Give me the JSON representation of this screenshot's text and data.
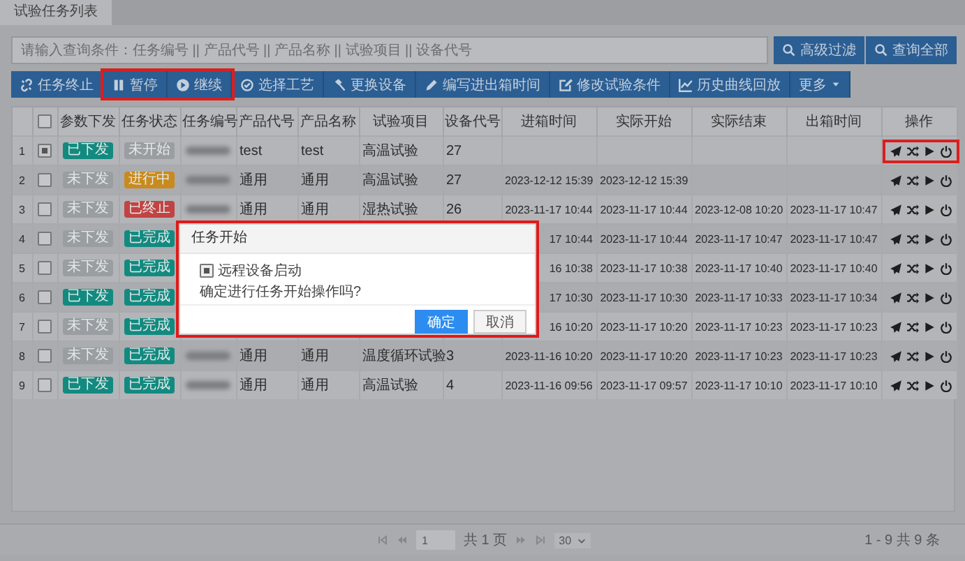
{
  "tabs": [
    {
      "label": "试验任务列表",
      "selected": true
    }
  ],
  "search": {
    "placeholder": "请输入查询条件：任务编号 || 产品代号 || 产品名称 || 试验项目 || 设备代号",
    "buttons": [
      "高级过滤",
      "查询全部"
    ]
  },
  "toolbar": [
    {
      "label": "任务终止",
      "highlighted": false
    },
    {
      "label": "暂停",
      "highlighted": true
    },
    {
      "label": "继续",
      "highlighted": true
    },
    {
      "label": "选择工艺",
      "highlighted": false
    },
    {
      "label": "更换设备",
      "highlighted": false
    },
    {
      "label": "编写进出箱时间",
      "highlighted": false
    },
    {
      "label": "修改试验条件",
      "highlighted": false
    },
    {
      "label": "历史曲线回放",
      "highlighted": false
    },
    {
      "label": "更多",
      "highlighted": false
    }
  ],
  "table": {
    "select_all_checked": false,
    "columns": [
      "参数下发",
      "任务状态",
      "任务编号",
      "产品代号",
      "产品名称",
      "试验项目",
      "设备代号",
      "进箱时间",
      "实际开始",
      "实际结束",
      "出箱时间",
      "操作"
    ],
    "rows": [
      {
        "index": "1",
        "checked": true,
        "param": {
          "label": "已下发",
          "color": "#138a80"
        },
        "status": {
          "label": "未开始",
          "color": "#9a9ea2"
        },
        "task_number_blurred": true,
        "product_code": "test",
        "product_name": "test",
        "test_item": "高温试验",
        "device_code": "27",
        "actions_highlighted": true
      },
      {
        "index": "2",
        "checked": false,
        "param": {
          "label": "未下发",
          "color": "#9a9ea2"
        },
        "status": {
          "label": "进行中",
          "color": "#c98a1e"
        },
        "task_number_blurred": true,
        "product_code": "通用",
        "product_name": "通用",
        "test_item": "高温试验",
        "device_code": "27",
        "entry_time": "2023-12-12 15:39",
        "actual_start": "2023-12-12 15:39",
        "actions_highlighted": false
      },
      {
        "index": "3",
        "checked": false,
        "param": {
          "label": "未下发",
          "color": "#9a9ea2"
        },
        "status": {
          "label": "已终止",
          "color": "#c24343"
        },
        "task_number_blurred": true,
        "product_code": "通用",
        "product_name": "通用",
        "test_item": "湿热试验",
        "device_code": "26",
        "entry_time": "2023-11-17 10:44",
        "actual_start": "2023-11-17 10:44",
        "actual_end": "2023-12-08 10:20",
        "exit_time": "2023-11-17 10:47",
        "actions_highlighted": false
      },
      {
        "index": "4",
        "checked": false,
        "param": {
          "label": "未下发",
          "color": "#9a9ea2"
        },
        "status": {
          "label": "已完成",
          "color": "#138a80"
        },
        "task_number_blurred": false,
        "entry_time": "17 10:44",
        "actual_start": "2023-11-17 10:44",
        "actual_end": "2023-11-17 10:47",
        "exit_time": "2023-11-17 10:47",
        "actions_highlighted": false
      },
      {
        "index": "5",
        "checked": false,
        "param": {
          "label": "未下发",
          "color": "#9a9ea2"
        },
        "status": {
          "label": "已完成",
          "color": "#138a80"
        },
        "task_number_blurred": false,
        "entry_time": "16 10:38",
        "actual_start": "2023-11-17 10:38",
        "actual_end": "2023-11-17 10:40",
        "exit_time": "2023-11-17 10:40",
        "actions_highlighted": false
      },
      {
        "index": "6",
        "checked": false,
        "param": {
          "label": "已下发",
          "color": "#138a80"
        },
        "status": {
          "label": "已完成",
          "color": "#138a80"
        },
        "task_number_blurred": false,
        "entry_time": "17 10:30",
        "actual_start": "2023-11-17 10:30",
        "actual_end": "2023-11-17 10:33",
        "exit_time": "2023-11-17 10:34",
        "actions_highlighted": false
      },
      {
        "index": "7",
        "checked": false,
        "param": {
          "label": "未下发",
          "color": "#9a9ea2"
        },
        "status": {
          "label": "已完成",
          "color": "#138a80"
        },
        "task_number_blurred": false,
        "entry_time": "16 10:20",
        "actual_start": "2023-11-17 10:20",
        "actual_end": "2023-11-17 10:23",
        "exit_time": "2023-11-17 10:23",
        "actions_highlighted": false
      },
      {
        "index": "8",
        "checked": false,
        "param": {
          "label": "未下发",
          "color": "#9a9ea2"
        },
        "status": {
          "label": "已完成",
          "color": "#138a80"
        },
        "task_number_blurred": true,
        "product_code": "通用",
        "product_name": "通用",
        "test_item": "温度循环试验",
        "device_code": "3",
        "entry_time": "2023-11-16 10:20",
        "actual_start": "2023-11-17 10:20",
        "actual_end": "2023-11-17 10:23",
        "exit_time": "2023-11-17 10:23",
        "actions_highlighted": false
      },
      {
        "index": "9",
        "checked": false,
        "param": {
          "label": "已下发",
          "color": "#138a80"
        },
        "status": {
          "label": "已完成",
          "color": "#138a80"
        },
        "task_number_blurred": true,
        "product_code": "通用",
        "product_name": "通用",
        "test_item": "高温试验",
        "device_code": "4",
        "entry_time": "2023-11-16 09:56",
        "actual_start": "2023-11-17 09:57",
        "actual_end": "2023-11-17 10:10",
        "exit_time": "2023-11-17 10:10",
        "actions_highlighted": false
      }
    ]
  },
  "dialog": {
    "title": "任务开始",
    "checkbox": {
      "label": "远程设备启动",
      "checked": true
    },
    "message": "确定进行任务开始操作吗?",
    "buttons": [
      {
        "label": "确定",
        "primary": true
      },
      {
        "label": "取消",
        "primary": false
      }
    ],
    "highlighted": true
  },
  "pager": {
    "page": "1",
    "total_pages": "共 1 页",
    "page_size": "30",
    "summary": "1 - 9 共 9 条"
  }
}
